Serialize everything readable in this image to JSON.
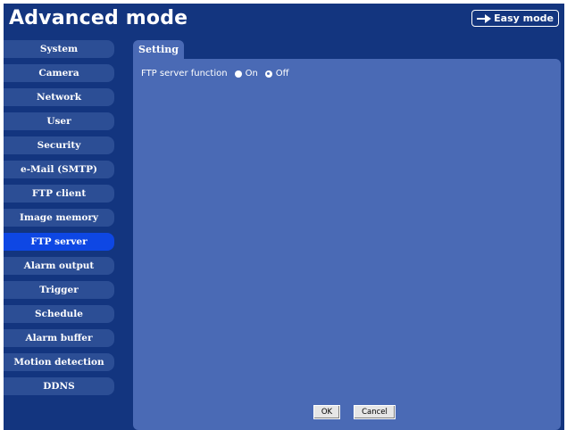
{
  "header": {
    "title": "Advanced mode",
    "easy_mode_label": "Easy mode"
  },
  "sidebar": {
    "items": [
      {
        "label": "System"
      },
      {
        "label": "Camera"
      },
      {
        "label": "Network"
      },
      {
        "label": "User"
      },
      {
        "label": "Security"
      },
      {
        "label": "e-Mail (SMTP)"
      },
      {
        "label": "FTP client"
      },
      {
        "label": "Image memory"
      },
      {
        "label": "FTP server",
        "active": true
      },
      {
        "label": "Alarm output"
      },
      {
        "label": "Trigger"
      },
      {
        "label": "Schedule"
      },
      {
        "label": "Alarm buffer"
      },
      {
        "label": "Motion detection"
      },
      {
        "label": "DDNS"
      }
    ]
  },
  "main": {
    "tab_label": "Setting",
    "ftp_server_function": {
      "label": "FTP server function",
      "options": [
        "On",
        "Off"
      ],
      "selected": "Off"
    },
    "ok_label": "OK",
    "cancel_label": "Cancel"
  },
  "colors": {
    "background": "#13357f",
    "panel": "#4a6ab5",
    "sidebar_item": "#2c4e95",
    "sidebar_active": "#0e47e4"
  },
  "icons": {
    "easy_mode": "arrow-right-icon"
  }
}
